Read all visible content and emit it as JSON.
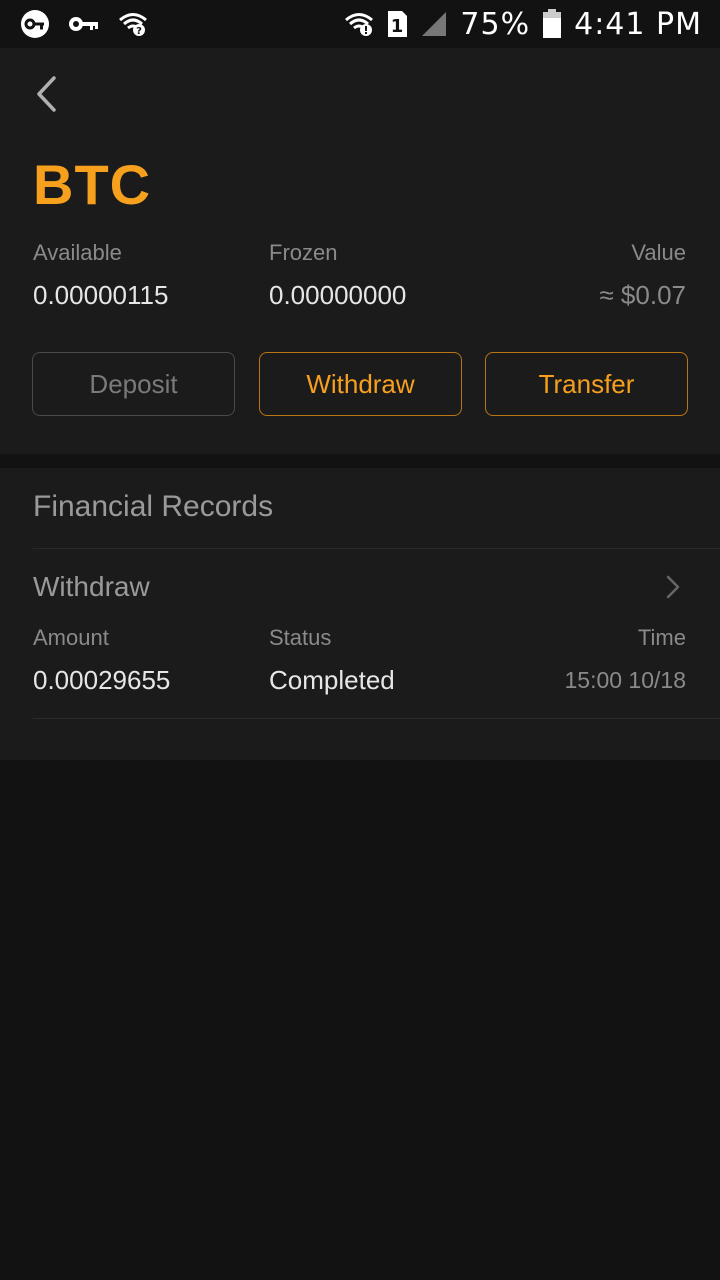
{
  "status_bar": {
    "battery_percent": "75%",
    "time": "4:41 PM",
    "sim_slot": "1",
    "icons": [
      "vpn-key-icon",
      "key-icon",
      "wifi-question-icon",
      "wifi-alert-icon",
      "sim-1-icon",
      "signal-icon",
      "battery-icon"
    ]
  },
  "header": {
    "coin": "BTC",
    "available_label": "Available",
    "available_value": "0.00000115",
    "frozen_label": "Frozen",
    "frozen_value": "0.00000000",
    "value_label": "Value",
    "value_amount": "≈ $0.07"
  },
  "actions": {
    "deposit": "Deposit",
    "withdraw": "Withdraw",
    "transfer": "Transfer"
  },
  "records": {
    "title": "Financial Records",
    "items": [
      {
        "type": "Withdraw",
        "amount_label": "Amount",
        "amount": "0.00029655",
        "status_label": "Status",
        "status": "Completed",
        "time_label": "Time",
        "time": "15:00 10/18"
      }
    ]
  },
  "colors": {
    "accent": "#f7a01e",
    "panel": "#1b1b1b",
    "background": "#121212"
  }
}
